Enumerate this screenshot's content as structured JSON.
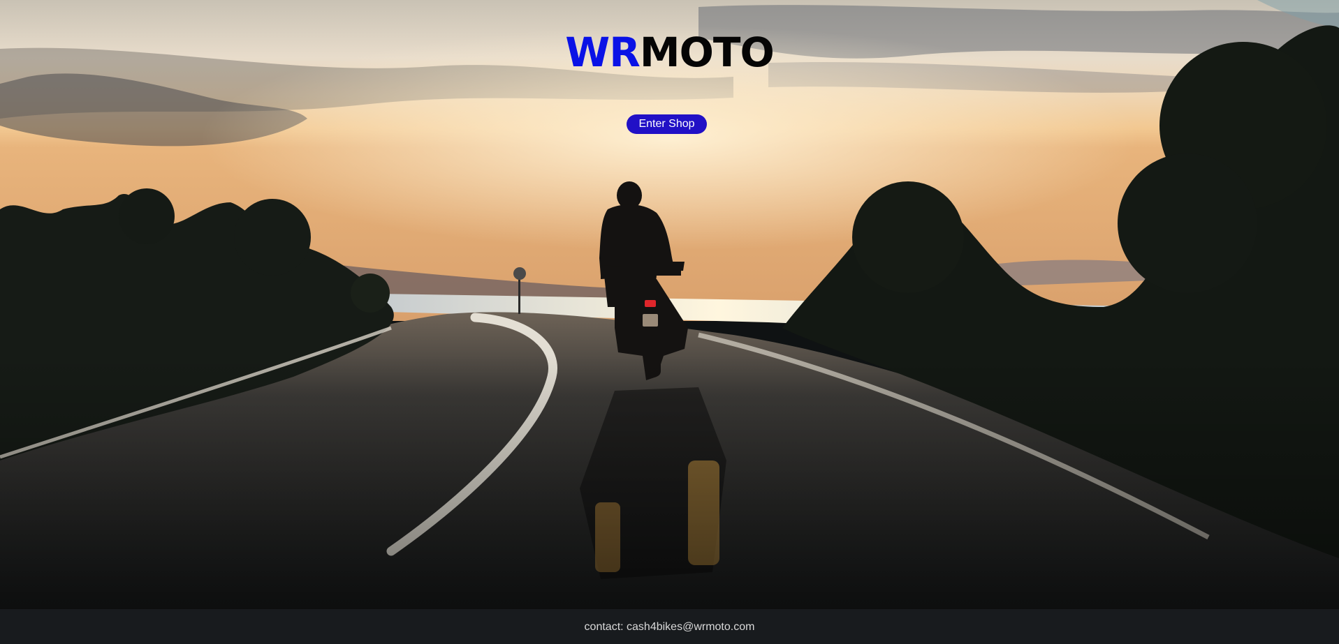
{
  "logo": {
    "prefix": "WR",
    "suffix": "MOTO",
    "prefix_color": "#0a12e6",
    "suffix_color": "#050505"
  },
  "hero": {
    "enter_label": "Enter Shop",
    "button_color": "#2110c6"
  },
  "footer": {
    "contact_text": "contact: cash4bikes@wrmoto.com"
  }
}
